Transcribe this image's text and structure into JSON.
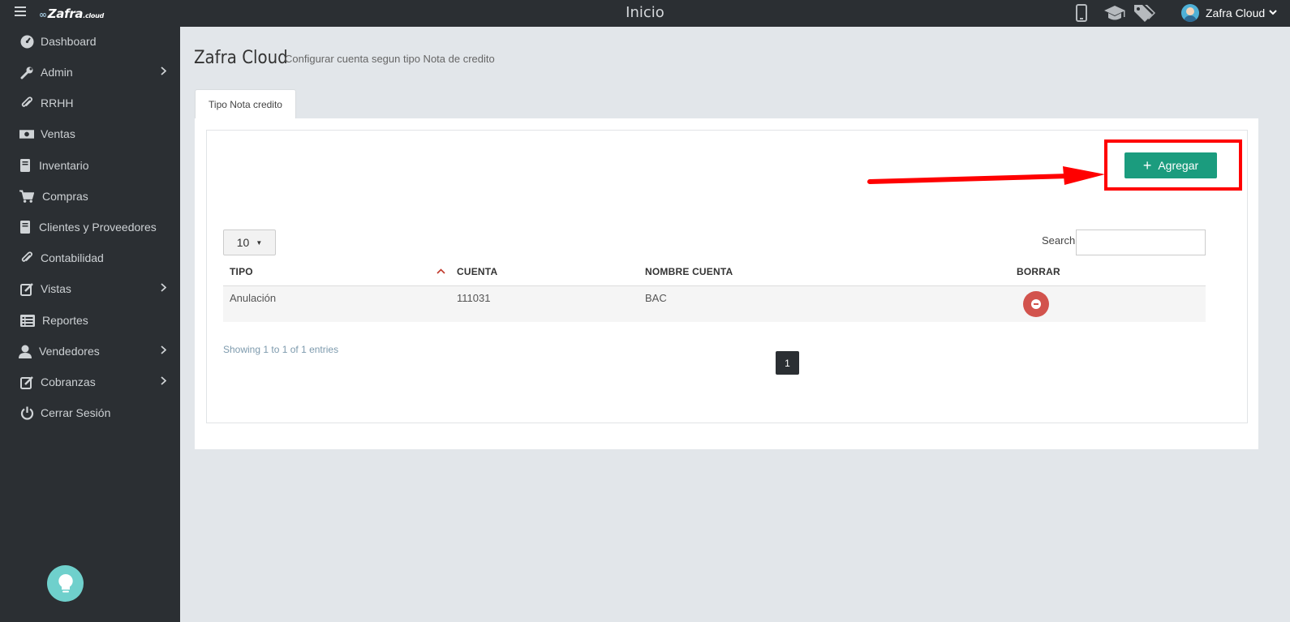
{
  "topbar": {
    "logo_text": "Zafra",
    "logo_suffix": ".cloud",
    "title": "Inicio",
    "user_name": "Zafra Cloud"
  },
  "icons": {
    "menu": "hamburger-icon",
    "mobile": "mobile-phone-icon",
    "graduation": "graduation-cap-icon",
    "tags": "tags-icon",
    "bulb": "lightbulb-icon"
  },
  "sidebar": {
    "items": [
      {
        "label": "Dashboard",
        "icon": "dashboard-icon",
        "has_children": false
      },
      {
        "label": "Admin",
        "icon": "wrench-icon",
        "has_children": true
      },
      {
        "label": "RRHH",
        "icon": "paperclip-icon",
        "has_children": false
      },
      {
        "label": "Ventas",
        "icon": "money-icon",
        "has_children": false
      },
      {
        "label": "Inventario",
        "icon": "book-icon",
        "has_children": false
      },
      {
        "label": "Compras",
        "icon": "cart-icon",
        "has_children": false
      },
      {
        "label": "Clientes y Proveedores",
        "icon": "book-icon",
        "has_children": false
      },
      {
        "label": "Contabilidad",
        "icon": "paperclip-icon",
        "has_children": false
      },
      {
        "label": "Vistas",
        "icon": "edit-icon",
        "has_children": true
      },
      {
        "label": "Reportes",
        "icon": "list-icon",
        "has_children": false
      },
      {
        "label": "Vendedores",
        "icon": "user-icon",
        "has_children": true
      },
      {
        "label": "Cobranzas",
        "icon": "edit-icon",
        "has_children": true
      },
      {
        "label": "Cerrar Sesión",
        "icon": "power-icon",
        "has_children": false
      }
    ]
  },
  "main": {
    "page_title": "Zafra Cloud",
    "page_subtitle": "Configurar cuenta segun tipo Nota de credito",
    "tab_label": "Tipo Nota credito",
    "add_button_label": "Agregar",
    "length_value": "10",
    "search_label": "Search:",
    "search_value": "",
    "columns": [
      "TIPO",
      "CUENTA",
      "NOMBRE CUENTA",
      "BORRAR"
    ],
    "rows": [
      {
        "tipo": "Anulación",
        "cuenta": "111031",
        "nombre_cuenta": "BAC"
      }
    ],
    "info_text": "Showing 1 to 1 of 1 entries",
    "current_page": "1"
  },
  "colors": {
    "sidebar_bg": "#2b2f33",
    "accent_green": "#1b9c7e",
    "delete_red": "#d2534d",
    "annotation_red": "#ff0000"
  }
}
